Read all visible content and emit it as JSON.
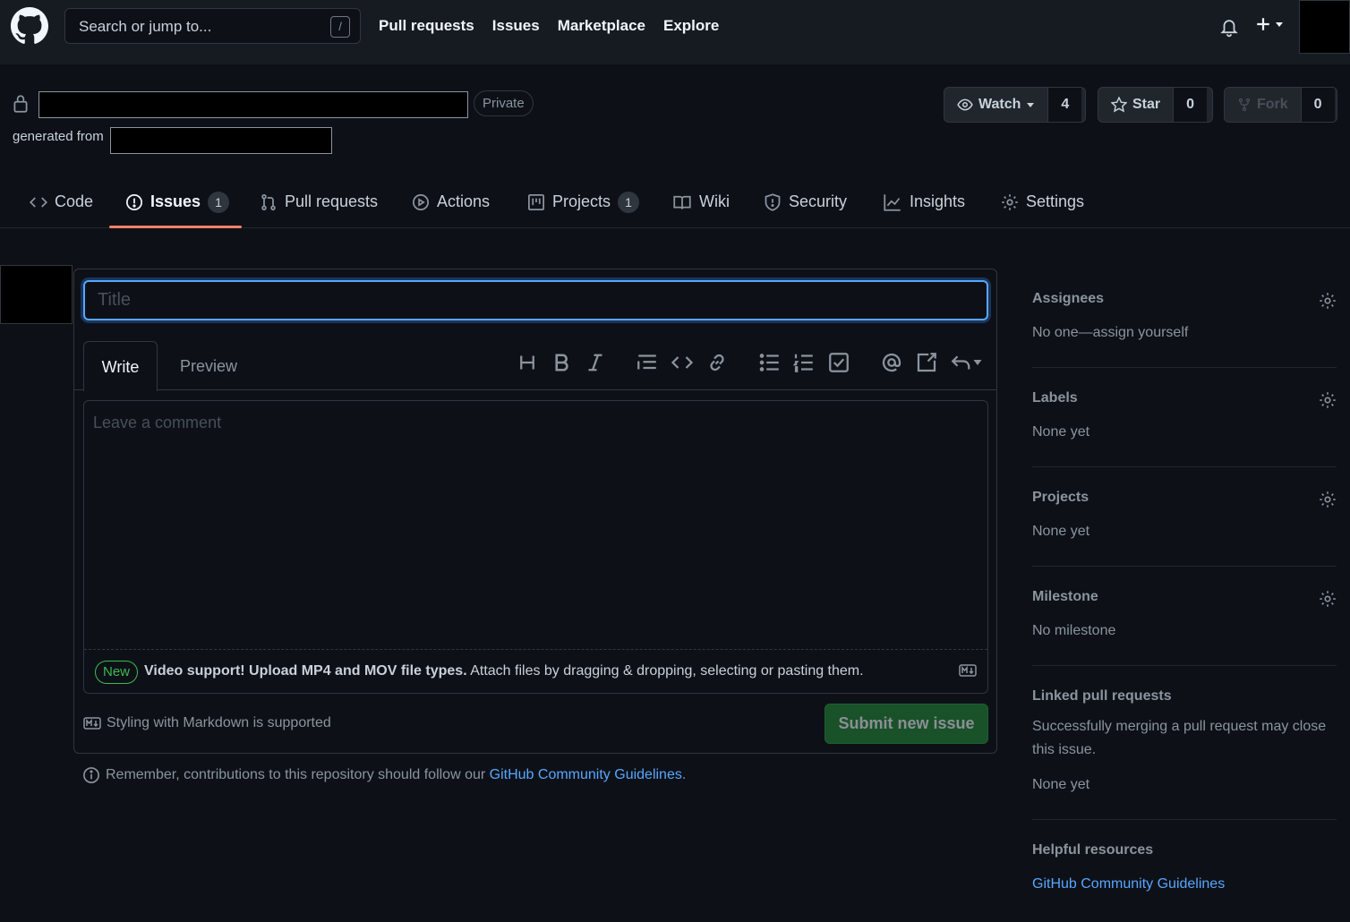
{
  "header": {
    "search_placeholder": "Search or jump to...",
    "search_shortcut": "/",
    "nav": [
      "Pull requests",
      "Issues",
      "Marketplace",
      "Explore"
    ]
  },
  "repo": {
    "visibility": "Private",
    "generated_from_label": "generated from",
    "watch": {
      "label": "Watch",
      "count": "4"
    },
    "star": {
      "label": "Star",
      "count": "0"
    },
    "fork": {
      "label": "Fork",
      "count": "0"
    }
  },
  "tabs": [
    {
      "label": "Code"
    },
    {
      "label": "Issues",
      "count": "1"
    },
    {
      "label": "Pull requests"
    },
    {
      "label": "Actions"
    },
    {
      "label": "Projects",
      "count": "1"
    },
    {
      "label": "Wiki"
    },
    {
      "label": "Security"
    },
    {
      "label": "Insights"
    },
    {
      "label": "Settings"
    }
  ],
  "form": {
    "title_placeholder": "Title",
    "write_tab": "Write",
    "preview_tab": "Preview",
    "comment_placeholder": "Leave a comment",
    "new_badge": "New",
    "drop_bold": "Video support! Upload MP4 and MOV file types.",
    "drop_text": " Attach files by dragging & dropping, selecting or pasting them.",
    "markdown_note": "Styling with Markdown is supported",
    "submit": "Submit new issue"
  },
  "remember": {
    "text": "Remember, contributions to this repository should follow our ",
    "link": "GitHub Community Guidelines",
    "end": "."
  },
  "sidebar": {
    "assignees": {
      "title": "Assignees",
      "value": "No one—assign yourself"
    },
    "labels": {
      "title": "Labels",
      "value": "None yet"
    },
    "projects": {
      "title": "Projects",
      "value": "None yet"
    },
    "milestone": {
      "title": "Milestone",
      "value": "No milestone"
    },
    "linked": {
      "title": "Linked pull requests",
      "desc": "Successfully merging a pull request may close this issue.",
      "value": "None yet"
    },
    "helpful": {
      "title": "Helpful resources",
      "link": "GitHub Community Guidelines"
    }
  },
  "colors": {
    "accent": "#58a6ff",
    "tab_underline": "#f78166",
    "submit": "#238636",
    "background": "#0d1117"
  }
}
